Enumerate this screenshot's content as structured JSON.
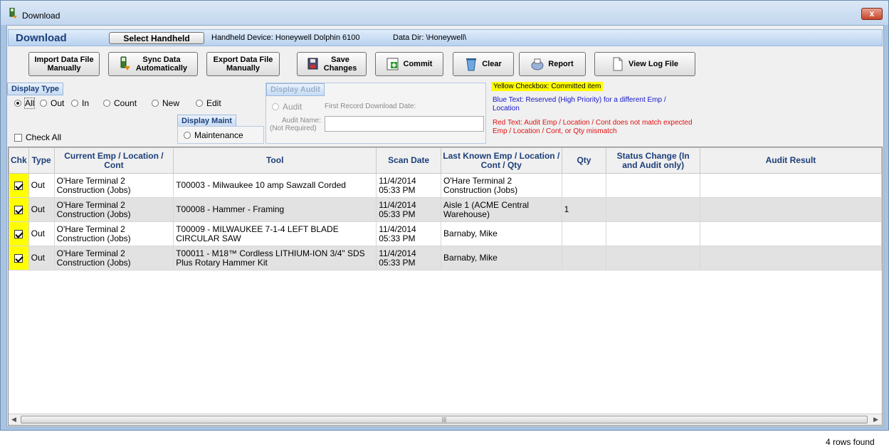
{
  "window": {
    "title": "Download",
    "close_label": "x"
  },
  "header": {
    "title": "Download",
    "select_handheld_label": "Select Handheld",
    "device_text": "Handheld Device:  Honeywell Dolphin 6100",
    "data_dir_text": "Data Dir:  \\Honeywell\\"
  },
  "toolbar": {
    "import_label": "Import Data File\nManually",
    "sync_label": "Sync Data\nAutomatically",
    "export_label": "Export Data File\nManually",
    "save_label": "Save\nChanges",
    "commit_label": "Commit",
    "clear_label": "Clear",
    "report_label": "Report",
    "view_log_label": "View Log File"
  },
  "display_type": {
    "title": "Display Type",
    "options": [
      "All",
      "Out",
      "In",
      "Count",
      "New",
      "Edit"
    ],
    "selected": "All",
    "check_all_label": "Check All"
  },
  "display_maint": {
    "title": "Display Maint",
    "option": "Maintenance"
  },
  "display_audit": {
    "title": "Display Audit",
    "audit_label": "Audit",
    "first_record_label": "First Record Download Date:",
    "audit_name_label": "Audit Name:",
    "not_required_label": "(Not Required)",
    "audit_name_value": ""
  },
  "legend": {
    "yellow": "Yellow Checkbox:  Committed item",
    "blue": "Blue Text:  Reserved (High Priority) for a different Emp / Location",
    "red": "Red Text:  Audit Emp / Location / Cont does not match expected Emp / Location / Cont, or Qty mismatch",
    "colors": {
      "yellow": "#ffff00",
      "blue": "#1616c8",
      "red": "#e01010"
    }
  },
  "grid": {
    "columns": [
      "Chk",
      "Type",
      "Current Emp / Location / Cont",
      "Tool",
      "Scan Date",
      "Last Known Emp / Location / Cont / Qty",
      "Qty",
      "Status Change (In and Audit only)",
      "Audit Result"
    ],
    "rows": [
      {
        "checked": true,
        "type": "Out",
        "current": "O'Hare Terminal 2 Construction (Jobs)",
        "tool": "T00003 - Milwaukee 10 amp Sawzall Corded",
        "scan_date": "11/4/2014 05:33 PM",
        "last_known": "O'Hare Terminal 2 Construction (Jobs)",
        "qty": "",
        "status_change": "",
        "audit_result": ""
      },
      {
        "checked": true,
        "type": "Out",
        "current": "O'Hare Terminal 2 Construction (Jobs)",
        "tool": "T00008 - Hammer - Framing",
        "scan_date": "11/4/2014 05:33 PM",
        "last_known": "Aisle 1 (ACME Central Warehouse)",
        "qty": "1",
        "status_change": "",
        "audit_result": ""
      },
      {
        "checked": true,
        "type": "Out",
        "current": "O'Hare Terminal 2 Construction (Jobs)",
        "tool": "T00009 - MILWAUKEE 7-1-4 LEFT BLADE CIRCULAR SAW",
        "scan_date": "11/4/2014 05:33 PM",
        "last_known": "Barnaby, Mike",
        "qty": "",
        "status_change": "",
        "audit_result": ""
      },
      {
        "checked": true,
        "type": "Out",
        "current": "O'Hare Terminal 2 Construction (Jobs)",
        "tool": "T00011 - M18™ Cordless LITHIUM-ION 3/4\" SDS Plus Rotary Hammer Kit",
        "scan_date": "11/4/2014 05:33 PM",
        "last_known": "Barnaby, Mike",
        "qty": "",
        "status_change": "",
        "audit_result": ""
      }
    ]
  },
  "status": {
    "rows_found": "4 rows found"
  }
}
